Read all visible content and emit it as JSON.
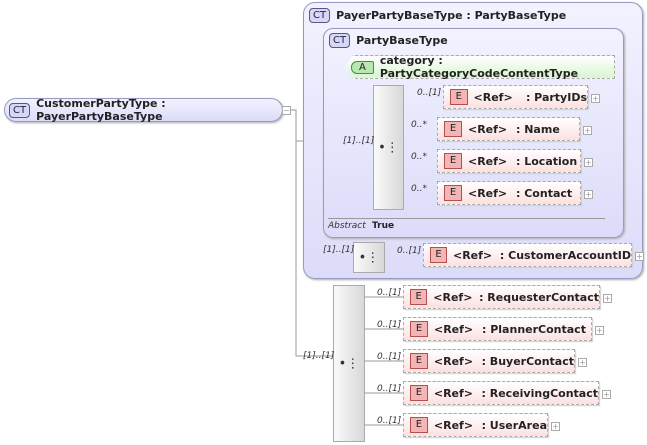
{
  "root": {
    "badge": "CT",
    "label": "CustomerPartyType : PayerPartyBaseType"
  },
  "outer": {
    "badge": "CT",
    "label": "PayerPartyBaseType : PartyBaseType"
  },
  "inner": {
    "badge": "CT",
    "label": "PartyBaseType",
    "abstract_label": "Abstract",
    "abstract_value": "True"
  },
  "attribute": {
    "badge": "A",
    "label": "category : PartyCategoryCodeContentType"
  },
  "seq_cards": {
    "inner": "[1]..[1]",
    "outer": "[1]..[1]",
    "lower": "[1]..[1]"
  },
  "inner_elements": [
    {
      "card": "0..[1]",
      "ref": "<Ref>",
      "name": ": PartyIDs"
    },
    {
      "card": "0..*",
      "ref": "<Ref>",
      "name": ": Name"
    },
    {
      "card": "0..*",
      "ref": "<Ref>",
      "name": ": Location"
    },
    {
      "card": "0..*",
      "ref": "<Ref>",
      "name": ": Contact"
    }
  ],
  "outer_elements": [
    {
      "card": "0..[1]",
      "ref": "<Ref>",
      "name": ": CustomerAccountID"
    }
  ],
  "lower_elements": [
    {
      "card": "0..[1]",
      "ref": "<Ref>",
      "name": ": RequesterContact"
    },
    {
      "card": "0..[1]",
      "ref": "<Ref>",
      "name": ": PlannerContact"
    },
    {
      "card": "0..[1]",
      "ref": "<Ref>",
      "name": ": BuyerContact"
    },
    {
      "card": "0..[1]",
      "ref": "<Ref>",
      "name": ": ReceivingContact"
    },
    {
      "card": "0..[1]",
      "ref": "<Ref>",
      "name": ": UserArea"
    }
  ],
  "element_badge": "E",
  "seq_icon": "sequence-icon"
}
